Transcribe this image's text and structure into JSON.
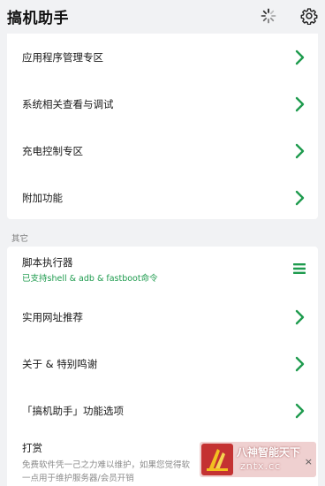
{
  "appbar": {
    "title": "搞机助手",
    "loading_icon": "loading-spinner-icon",
    "settings_icon": "gear-icon"
  },
  "section1": {
    "items": [
      {
        "label": "应用程序管理专区"
      },
      {
        "label": "系统相关查看与调试"
      },
      {
        "label": "充电控制专区"
      },
      {
        "label": "附加功能"
      }
    ]
  },
  "section2": {
    "header": "其它",
    "script_runner": {
      "title": "脚本执行器",
      "subtitle": "已支持shell & adb & fastboot命令"
    },
    "items": [
      {
        "label": "实用网址推荐"
      },
      {
        "label": "关于 & 特别鸣谢"
      },
      {
        "label": "「搞机助手」功能选项"
      }
    ],
    "reward": {
      "title": "打赏",
      "desc_line1": "免费软件凭一己之力难以维护，如果您觉得软",
      "desc_line2": "一点用于维护服务器/会员开销"
    }
  },
  "watermark": {
    "line1": "八神智能天下",
    "line2": "zntx.cc",
    "close": "×"
  },
  "colors": {
    "accent": "#1e9b4e",
    "background": "#f1f2f4",
    "card": "#ffffff"
  }
}
